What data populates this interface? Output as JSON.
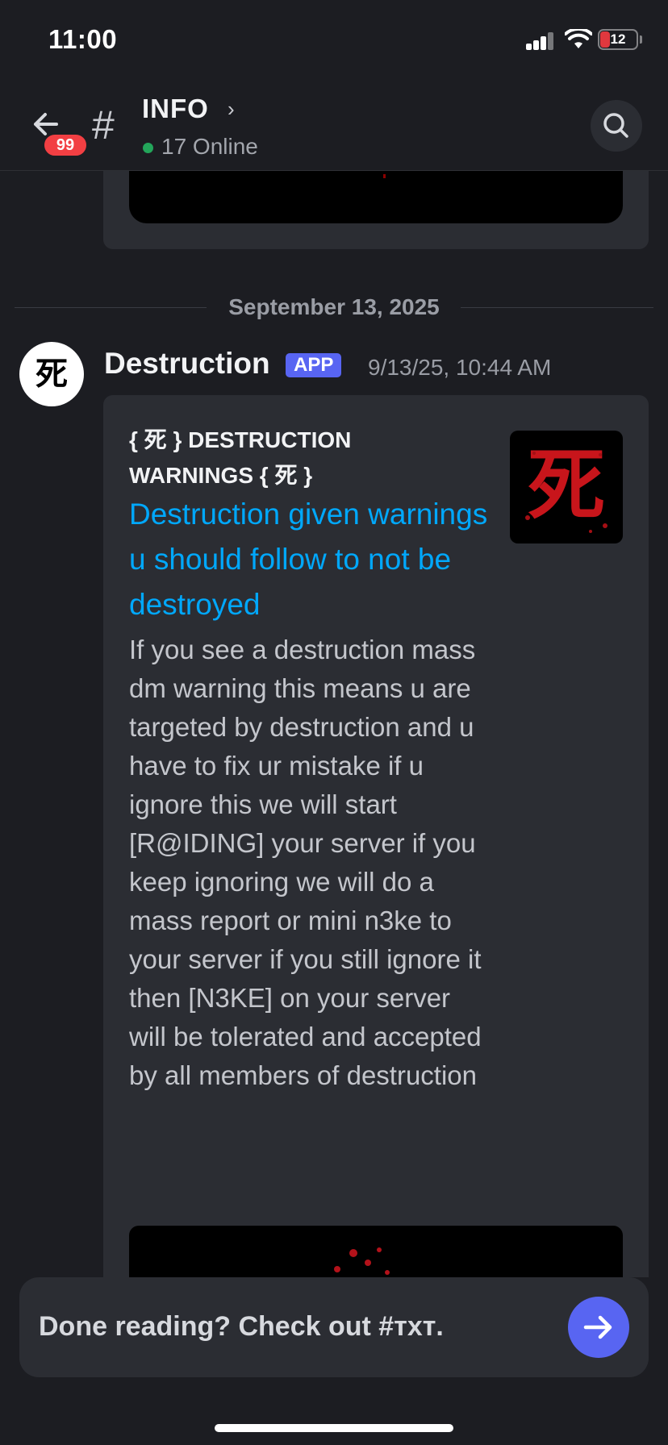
{
  "status_bar": {
    "time": "11:00",
    "battery_level": "12",
    "battery_color": "#e0383e"
  },
  "header": {
    "unread_badge": "99",
    "channel_hash": "#",
    "channel_name": "INFO",
    "chevron": "›",
    "online_text": "17 Online",
    "online_color": "#23a55a"
  },
  "divider": {
    "date": "September 13, 2025"
  },
  "message": {
    "avatar_glyph": "死",
    "author": "Destruction",
    "app_tag": "APP",
    "timestamp": "9/13/25, 10:44 AM",
    "embed": {
      "author": "{ 死 } DESTRUCTION WARNINGS { 死 }",
      "title": "Destruction given warnings u should follow to not be destroyed",
      "title_color": "#00a8fc",
      "thumbnail_glyph": "死",
      "description": "If you see a destruction mass dm warning this means u are targeted by destruction and u have to fix ur mistake if u ignore this we will start [R@IDING] your server if you keep ignoring we will do a mass report or mini n3ke to your server if you still ignore it then [N3KE] on your server will be tolerated and accepted by all members of destruction"
    }
  },
  "bottom_prompt": {
    "text": "Done reading? Check out #ᴛxᴛ.",
    "button_icon": "arrow-right-icon",
    "accent": "#5865f2"
  }
}
